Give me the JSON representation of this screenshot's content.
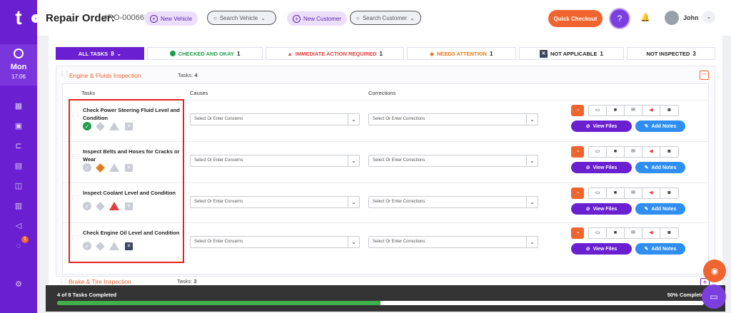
{
  "sidebar": {
    "logo": "t",
    "collapse": "›",
    "clock": {
      "day": "Mon",
      "time": "17:06"
    },
    "nav_icons": [
      "dashboard-icon",
      "calendar-icon",
      "workflow-icon",
      "invoice-icon",
      "shop-icon",
      "document-icon",
      "megaphone-icon",
      "chat-icon",
      "settings-icon"
    ],
    "chat_badge": "1"
  },
  "header": {
    "title": "Repair Order:",
    "ro_number": "#RO-000668",
    "new_vehicle": "New Vehicle",
    "search_vehicle": "Search Vehicle",
    "new_customer": "New Customer",
    "search_customer": "Search Customer",
    "quick_checkout": "Quick Checkout",
    "help": "?",
    "user_name": "John"
  },
  "filters": [
    {
      "label": "ALL TASKS",
      "count": "8"
    },
    {
      "label": "CHECKED AND OKAY",
      "count": "1"
    },
    {
      "label": "IMMEDIATE ACTION REQUIRED",
      "count": "1"
    },
    {
      "label": "NEEDS ATTENTION",
      "count": "1"
    },
    {
      "label": "NOT APPLICABLE",
      "count": "1"
    },
    {
      "label": "NOT INSPECTED",
      "count": "3"
    }
  ],
  "section": {
    "title": "Engine & Fluids Inspection",
    "tasks_label": "Tasks:",
    "tasks_count": "4",
    "columns": {
      "tasks": "Tasks",
      "causes": "Causes",
      "corrections": "Corrections"
    }
  },
  "rows": [
    {
      "name": "Check Power Steering Fluid Level and Condition",
      "status": "ok"
    },
    {
      "name": "Inspect Belts and Hoses for Cracks or Wear",
      "status": "attention"
    },
    {
      "name": "Inspect Coolant Level and Condition",
      "status": "immediate"
    },
    {
      "name": "Check Engine Oil Level and Condition",
      "status": "na"
    }
  ],
  "row_controls": {
    "causes_placeholder": "Select Or Enter Concerns",
    "corrections_placeholder": "Select Or Enter Corrections",
    "view_files": "View Files",
    "add_notes": "Add Notes"
  },
  "next_section": {
    "title": "Brake & Tire Inspection",
    "tasks_label": "Tasks:",
    "tasks_count": "3"
  },
  "progress": {
    "text": "4 of 8 Tasks Completed",
    "percent_label": "50% Complete",
    "fraction": 0.5
  },
  "colors": {
    "brand": "#6a1fd1",
    "accent": "#f0652f",
    "ok": "#1e9e4a",
    "danger": "#e33d3d",
    "warning": "#e77a1a",
    "info": "#2f8ef0"
  }
}
